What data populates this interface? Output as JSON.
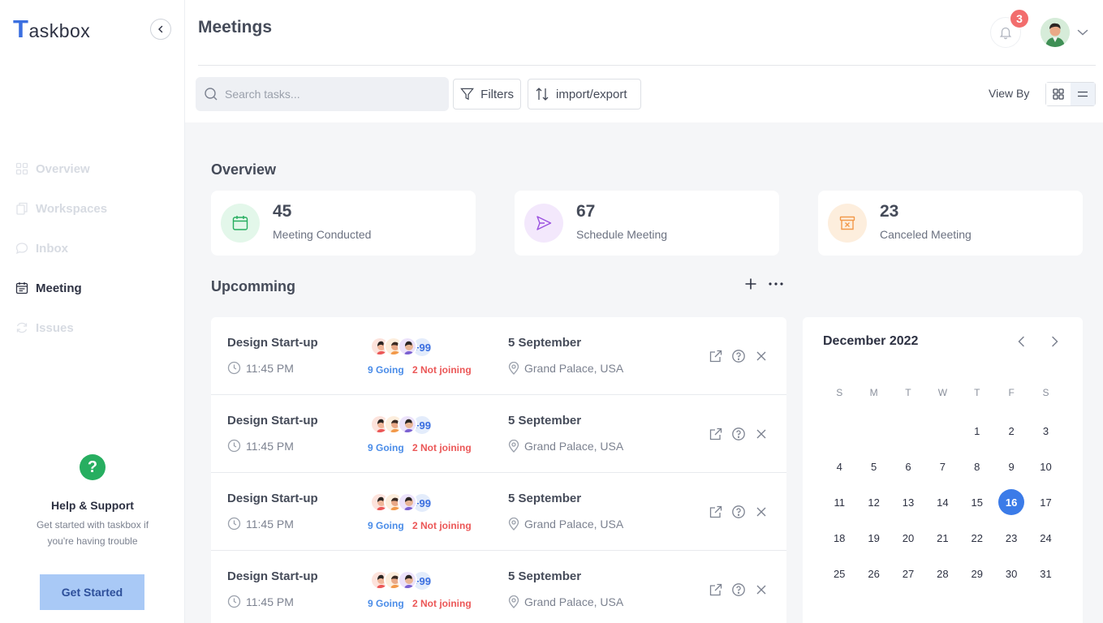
{
  "app": {
    "logo_initial": "T",
    "logo_rest": "askbox"
  },
  "sidebar": {
    "items": [
      {
        "label": "Overview",
        "icon": "grid-icon",
        "active": false
      },
      {
        "label": "Workspaces",
        "icon": "files-icon",
        "active": false
      },
      {
        "label": "Inbox",
        "icon": "chat-bubble-icon",
        "active": false
      },
      {
        "label": "Meeting",
        "icon": "calendar-icon",
        "active": true
      },
      {
        "label": "Issues",
        "icon": "sync-icon",
        "active": false
      }
    ],
    "help": {
      "icon_glyph": "?",
      "title": "Help & Support",
      "description": "Get started with taskbox if you're having trouble",
      "button_label": "Get Started"
    }
  },
  "header": {
    "title": "Meetings",
    "notification_count": "3",
    "search_placeholder": "Search tasks...",
    "filters_label": "Filters",
    "import_export_label": "import/export",
    "view_by_label": "View By"
  },
  "overview": {
    "title": "Overview",
    "stats": [
      {
        "value": "45",
        "label": "Meeting Conducted",
        "icon": "calendar-icon",
        "color": "#27ae60",
        "bg": "#e3f7ea"
      },
      {
        "value": "67",
        "label": "Schedule Meeting",
        "icon": "send-icon",
        "color": "#9b51e0",
        "bg": "#f3e8fc"
      },
      {
        "value": "23",
        "label": "Canceled Meeting",
        "icon": "archive-x-icon",
        "color": "#f2994a",
        "bg": "#fdeedd"
      }
    ]
  },
  "upcoming": {
    "title": "Upcomming",
    "meetings": [
      {
        "title": "Design Start-up",
        "time": "11:45 PM",
        "more": "+99",
        "going": "9 Going",
        "not_joining": "2 Not joining",
        "date": "5 September",
        "location": "Grand Palace, USA"
      },
      {
        "title": "Design Start-up",
        "time": "11:45 PM",
        "more": "+99",
        "going": "9 Going",
        "not_joining": "2 Not joining",
        "date": "5 September",
        "location": "Grand Palace, USA"
      },
      {
        "title": "Design Start-up",
        "time": "11:45 PM",
        "more": "+99",
        "going": "9 Going",
        "not_joining": "2 Not joining",
        "date": "5 September",
        "location": "Grand Palace, USA"
      },
      {
        "title": "Design Start-up",
        "time": "11:45 PM",
        "more": "+99",
        "going": "9 Going",
        "not_joining": "2 Not joining",
        "date": "5 September",
        "location": "Grand Palace, USA"
      }
    ]
  },
  "calendar": {
    "title": "December 2022",
    "weekdays": [
      "S",
      "M",
      "T",
      "W",
      "T",
      "F",
      "S"
    ],
    "leading_blanks": 4,
    "days": [
      "1",
      "2",
      "3",
      "4",
      "5",
      "6",
      "7",
      "8",
      "9",
      "10",
      "11",
      "12",
      "13",
      "14",
      "15",
      "16",
      "17",
      "18",
      "19",
      "20",
      "21",
      "22",
      "23",
      "24",
      "25",
      "26",
      "27",
      "28",
      "29",
      "30",
      "31"
    ],
    "selected": "16",
    "accent": "#3b7be8"
  }
}
